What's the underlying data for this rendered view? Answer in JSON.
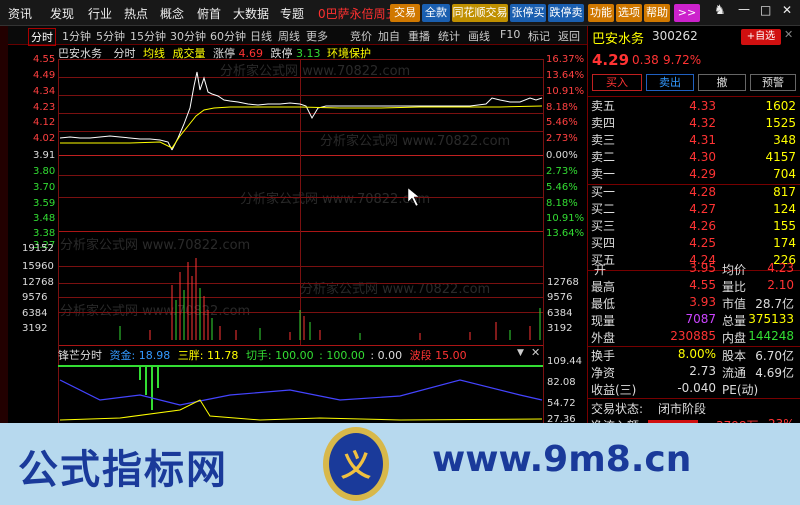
{
  "menu": {
    "items": [
      "资讯",
      "发现",
      "行业",
      "热点",
      "概念",
      "俯首",
      "大数据",
      "专题"
    ],
    "alert": "0巴萨永倍周五",
    "buttons": [
      "交易",
      "全款",
      "同花顺交易",
      "张停买",
      "跌停卖",
      "功能",
      "选项",
      "帮助"
    ],
    "more": ">>"
  },
  "toolbar": {
    "items": [
      "分时",
      "1分钟",
      "5分钟",
      "15分钟",
      "30分钟",
      "60分钟",
      "日线",
      "周线",
      "更多",
      "竞价",
      "加自",
      "重播",
      "统计",
      "画线",
      "F10",
      "标记",
      "返回"
    ]
  },
  "chart_header": {
    "name": "巴安水务",
    "mode": "分时",
    "avg": "均线",
    "vol": "成交量",
    "rise_label": "涨停",
    "rise_val": "4.69",
    "fall_label": "跌停",
    "fall_val": "3.13",
    "env": "环境保护"
  },
  "price_axis": {
    "left": [
      "4.55",
      "4.49",
      "4.34",
      "4.23",
      "4.12",
      "4.02",
      "3.91",
      "3.80",
      "3.70",
      "3.59",
      "3.48",
      "3.38",
      "3.27"
    ],
    "right": [
      "16.37%",
      "13.64%",
      "10.91%",
      "8.18%",
      "5.46%",
      "2.73%",
      "0.00%",
      "2.73%",
      "5.46%",
      "8.18%",
      "10.91%",
      "13.64%"
    ]
  },
  "volume_axis": {
    "left": [
      "19152",
      "15960",
      "12768",
      "9576",
      "6384",
      "3192"
    ],
    "right": [
      "12768",
      "9576",
      "6384",
      "3192"
    ]
  },
  "indicator": {
    "name": "锋芒分时",
    "label1": "资金:",
    "val1": "18.98",
    "label2": "三胖:",
    "val2": "11.78",
    "label3": "切手:",
    "val3": "100.00",
    "label4": ":",
    "val4": "100.00",
    "label5": ":",
    "val5": "0.00",
    "label6": "波段",
    "val6": "15.00",
    "axis": [
      "109.44",
      "82.08",
      "54.72",
      "27.36"
    ]
  },
  "colors": {
    "up": "#ff3333",
    "down": "#33dd33",
    "grid": "#7a1010",
    "yellow": "#ffff00",
    "white": "#ffffff",
    "cyan": "#33cccc",
    "blue": "#4444ff"
  },
  "watermark": "分析家公式网 www.70822.com",
  "stock": {
    "name": "巴安水务",
    "code": "300262",
    "add_btn": "+自选",
    "price": "4.29",
    "change": "0.38",
    "pct": "9.72%",
    "buy": "买入",
    "sell": "卖出",
    "cancel": "撤",
    "warn": "预警"
  },
  "asks": [
    {
      "label": "卖五",
      "price": "4.33",
      "vol": "1602"
    },
    {
      "label": "卖四",
      "price": "4.32",
      "vol": "1525"
    },
    {
      "label": "卖三",
      "price": "4.31",
      "vol": "348"
    },
    {
      "label": "卖二",
      "price": "4.30",
      "vol": "4157"
    },
    {
      "label": "卖一",
      "price": "4.29",
      "vol": "704"
    }
  ],
  "bids": [
    {
      "label": "买一",
      "price": "4.28",
      "vol": "817"
    },
    {
      "label": "买二",
      "price": "4.27",
      "vol": "124"
    },
    {
      "label": "买三",
      "price": "4.26",
      "vol": "155"
    },
    {
      "label": "买四",
      "price": "4.25",
      "vol": "174"
    },
    {
      "label": "买五",
      "price": "4.24",
      "vol": "226"
    }
  ],
  "quotes": [
    {
      "l1": "开",
      "v1": "3.95",
      "l2": "均价",
      "v2": "4.23"
    },
    {
      "l1": "最高",
      "v1": "4.55",
      "l2": "量比",
      "v2": "2.10"
    },
    {
      "l1": "最低",
      "v1": "3.93",
      "l2": "市值",
      "v2": "28.7亿"
    },
    {
      "l1": "现量",
      "v1": "7087",
      "l2": "总量",
      "v2": "375133"
    },
    {
      "l1": "外盘",
      "v1": "230885",
      "l2": "内盘",
      "v2": "144248"
    },
    {
      "l1": "换手",
      "v1": "8.00%",
      "l2": "股本",
      "v2": "6.70亿"
    },
    {
      "l1": "净资",
      "v1": "2.73",
      "l2": "流通",
      "v2": "4.69亿"
    },
    {
      "l1": "收益(三)",
      "v1": "-0.040",
      "l2": "PE(动)",
      "v2": ""
    }
  ],
  "trade_status": {
    "label": "交易状态:",
    "value": "闭市阶段"
  },
  "flow": {
    "label": "净流入额",
    "value": "3798万",
    "pct": "23%"
  },
  "banner": {
    "title": "公式指标网",
    "url": "www.9m8.cn",
    "logo_char": "义"
  }
}
